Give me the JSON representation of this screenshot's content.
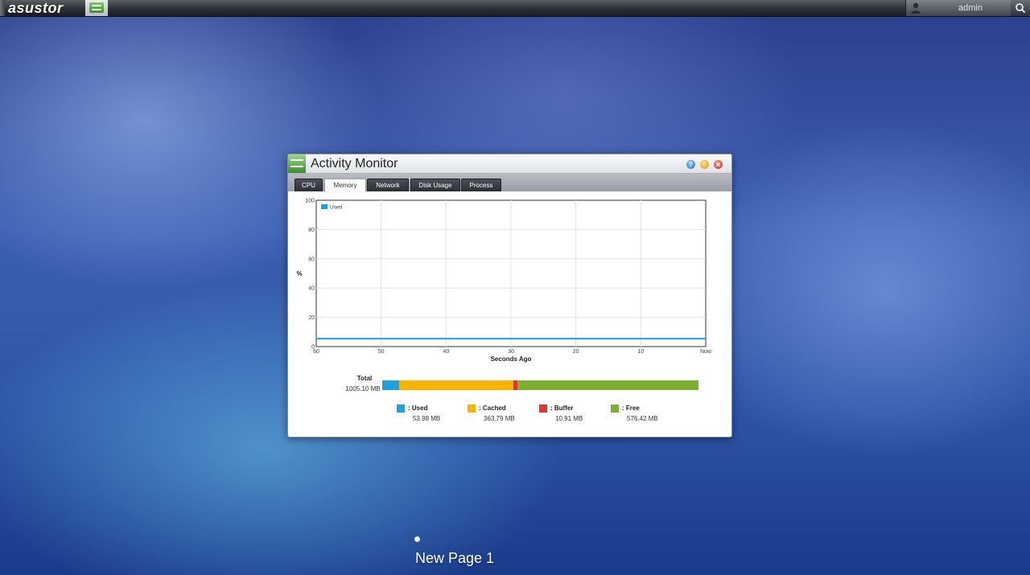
{
  "topbar": {
    "logo": "asustor",
    "username": "admin"
  },
  "window": {
    "title": "Activity Monitor",
    "help_label": "?",
    "tabs": [
      {
        "label": "CPU",
        "active": false
      },
      {
        "label": "Memory",
        "active": true
      },
      {
        "label": "Network",
        "active": false
      },
      {
        "label": "Disk Usage",
        "active": false
      },
      {
        "label": "Process",
        "active": false
      }
    ]
  },
  "chart_data": {
    "type": "line",
    "ylabel": "%",
    "xlabel": "Seconds Ago",
    "ylim": [
      0,
      100
    ],
    "yticks": [
      "0",
      "20",
      "40",
      "60",
      "80",
      "100"
    ],
    "xticks": [
      "60",
      "50",
      "40",
      "30",
      "20",
      "10",
      "Now"
    ],
    "grid": true,
    "legend": "top-left",
    "series": [
      {
        "name": "Used",
        "color": "#1ea1e1",
        "x": [
          60,
          50,
          40,
          30,
          20,
          10,
          0
        ],
        "y": [
          5.4,
          5.4,
          5.4,
          5.4,
          5.4,
          5.4,
          5.4
        ]
      }
    ]
  },
  "memory": {
    "total_label": "Total",
    "total_value": "1005.10 MB",
    "items": [
      {
        "label": ": Used",
        "value": "53.98 MB",
        "mb": 53.98,
        "color": "#1ea1e1"
      },
      {
        "label": ": Cached",
        "value": "363.79 MB",
        "mb": 363.79,
        "color": "#f7b500"
      },
      {
        "label": ": Buffer",
        "value": "10.91 MB",
        "mb": 10.91,
        "color": "#d73b2e"
      },
      {
        "label": ": Free",
        "value": "576.42 MB",
        "mb": 576.42,
        "color": "#7db02e"
      }
    ]
  },
  "desktop": {
    "page_name": "New Page 1"
  }
}
